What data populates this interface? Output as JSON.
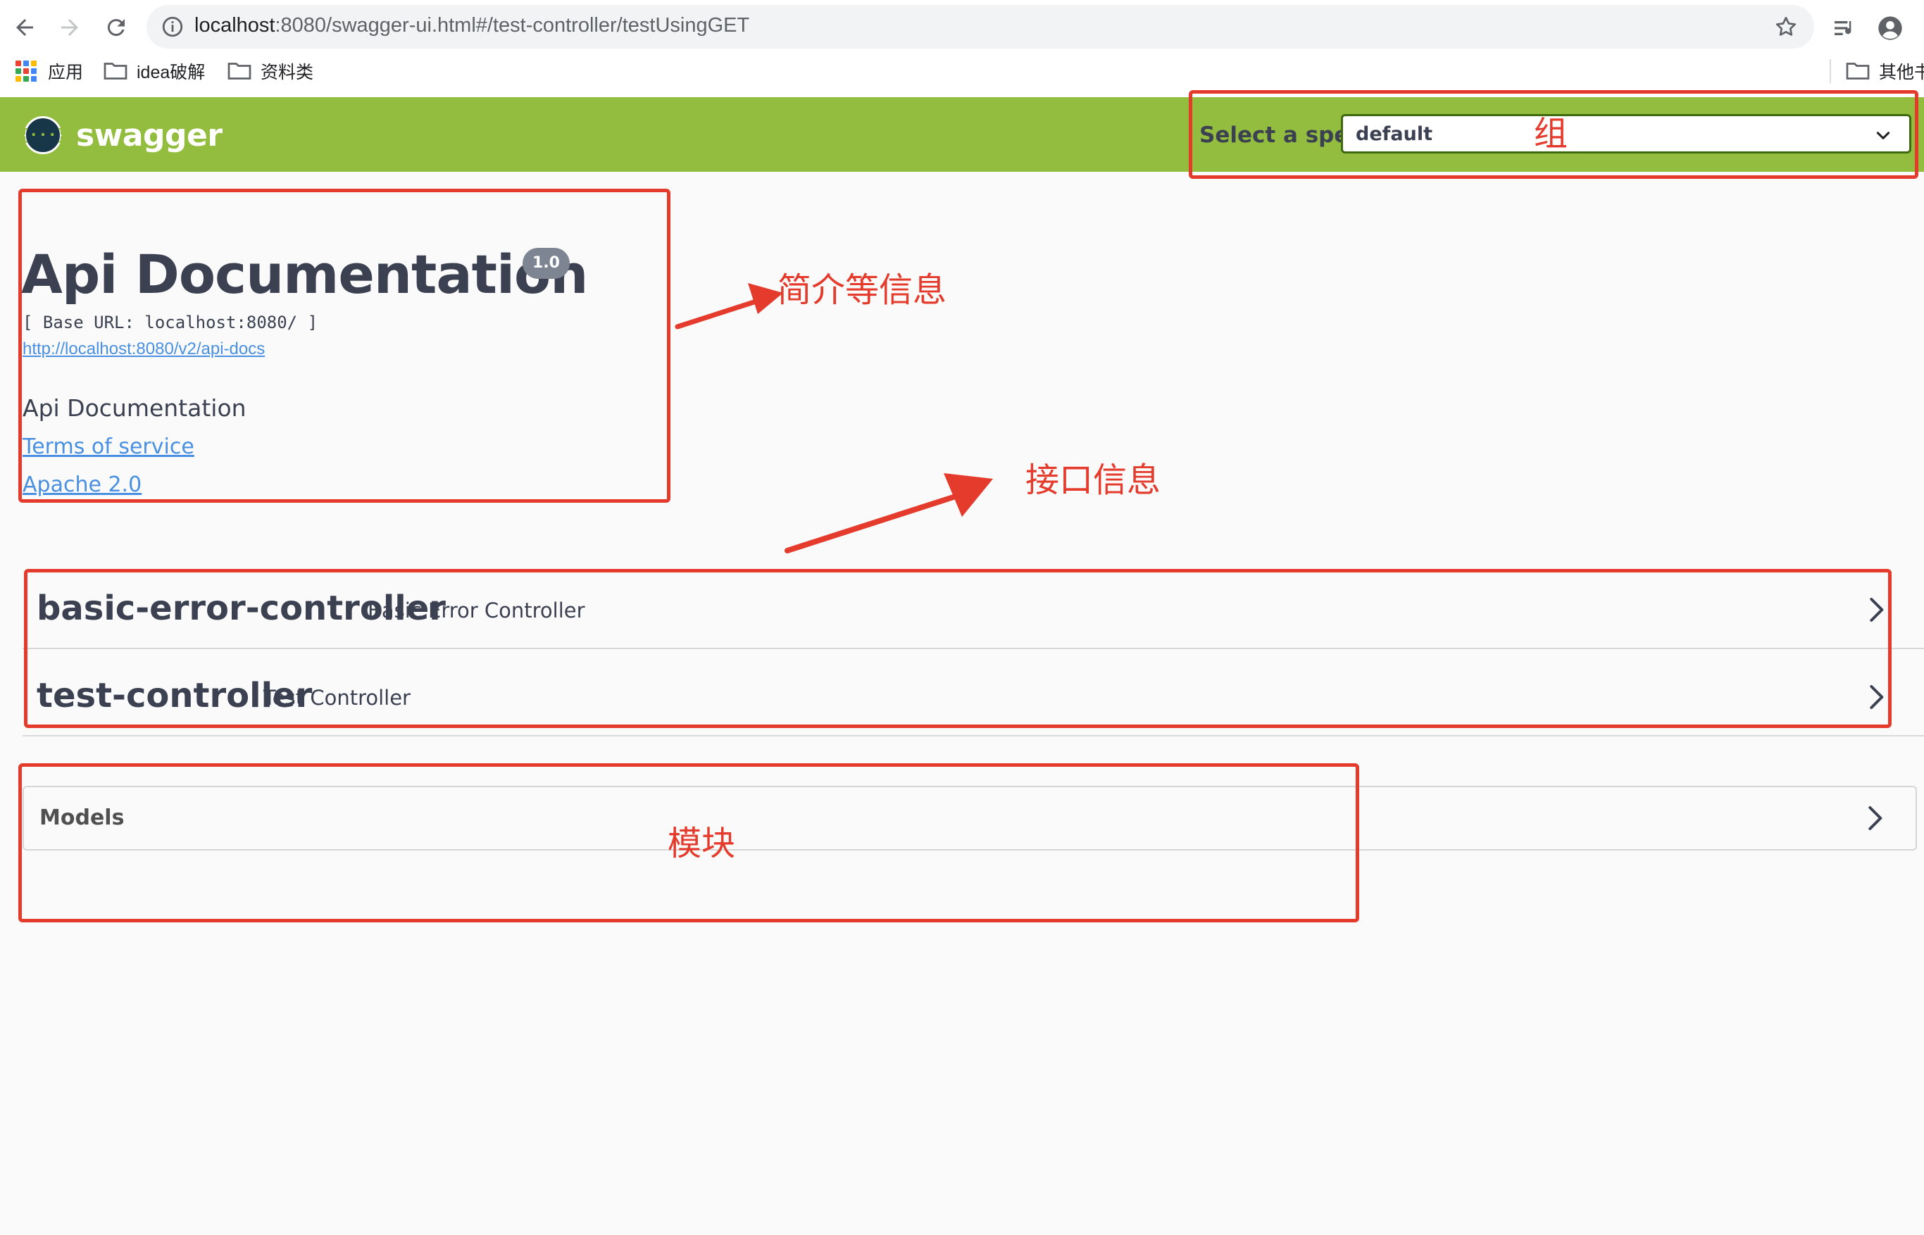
{
  "browser": {
    "url_host": "localhost",
    "url_rest": ":8080/swagger-ui.html#/test-controller/testUsingGET",
    "bookmarks": [
      {
        "label": "应用",
        "icon": "apps-grid-icon"
      },
      {
        "label": "idea破解",
        "icon": "folder-icon"
      },
      {
        "label": "资料类",
        "icon": "folder-icon"
      }
    ],
    "other_bookmarks": "其他书"
  },
  "topbar": {
    "logo_text": "swagger",
    "logo_mark": "{···}",
    "spec_label": "Select a spec",
    "spec_value": "default",
    "color": "#93bd3e"
  },
  "info": {
    "title": "Api Documentation",
    "version": "1.0",
    "base_url": "[ Base URL: localhost:8080/ ]",
    "docs_link": "http://localhost:8080/v2/api-docs",
    "description": "Api Documentation",
    "terms": "Terms of service",
    "license": "Apache 2.0"
  },
  "tags": [
    {
      "name": "basic-error-controller",
      "description": "Basic Error Controller"
    },
    {
      "name": "test-controller",
      "description": "Test Controller"
    }
  ],
  "models": {
    "title": "Models"
  },
  "annotations": {
    "group": "组",
    "intro": "简介等信息",
    "interfaces": "接口信息",
    "module": "模块",
    "color": "#e53b2c"
  }
}
